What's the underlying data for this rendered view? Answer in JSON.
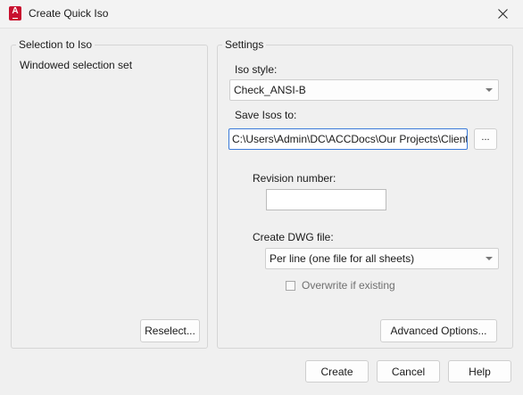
{
  "window": {
    "title": "Create Quick Iso",
    "app_icon_letter": "A"
  },
  "selection_group": {
    "label": "Selection to Iso",
    "value": "Windowed selection set",
    "reselect_label": "Reselect..."
  },
  "settings_group": {
    "label": "Settings",
    "iso_style_label": "Iso style:",
    "iso_style_value": "Check_ANSI-B",
    "save_isos_label": "Save Isos to:",
    "save_path_value": "C:\\Users\\Admin\\DC\\ACCDocs\\Our Projects\\Client",
    "browse_label": "...",
    "revision_label": "Revision number:",
    "revision_value": "",
    "create_dwg_label": "Create DWG file:",
    "create_dwg_value": "Per line (one file for all sheets)",
    "overwrite_label": "Overwrite if existing",
    "advanced_label": "Advanced Options..."
  },
  "footer": {
    "create_label": "Create",
    "cancel_label": "Cancel",
    "help_label": "Help"
  },
  "icons": {
    "app": "autocad-app-icon",
    "close": "close-icon",
    "dropdown": "chevron-down-icon"
  },
  "colors": {
    "app_icon": "#c8102e",
    "focus_border": "#3b7ad9"
  }
}
